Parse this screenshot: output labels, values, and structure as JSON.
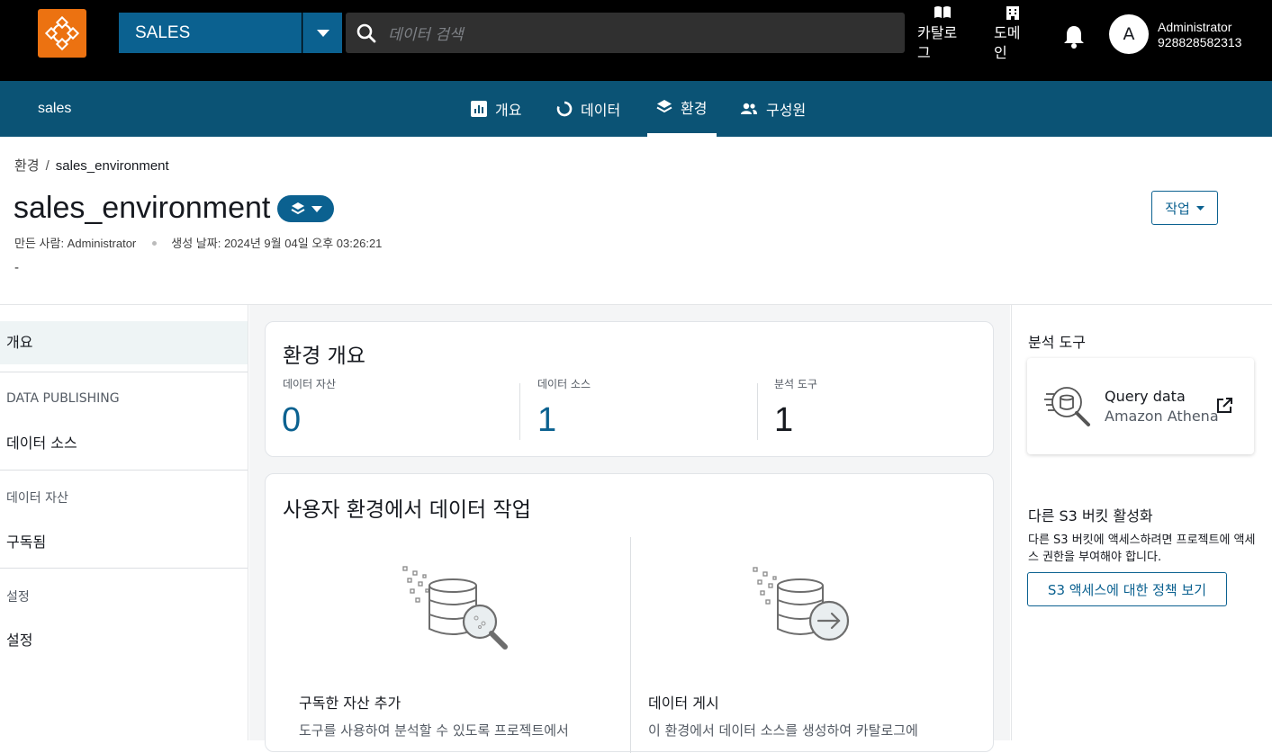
{
  "topbar": {
    "domain_selected": "SALES",
    "search_placeholder": "데이터 검색",
    "catalog_label": "카탈로\n그",
    "domain_label": "도메\n인",
    "avatar_initial": "A",
    "user_name": "Administrator",
    "user_account": "928828582313"
  },
  "project_nav": {
    "project_name": "sales",
    "tabs": [
      {
        "label": "개요",
        "icon": "bar-chart-icon"
      },
      {
        "label": "데이터",
        "icon": "circle-arrow-icon"
      },
      {
        "label": "환경",
        "icon": "layers-icon",
        "active": true
      },
      {
        "label": "구성원",
        "icon": "people-icon"
      }
    ]
  },
  "breadcrumb": {
    "parent": "환경",
    "separator": "/",
    "current": "sales_environment"
  },
  "header": {
    "title": "sales_environment",
    "created_by": "만든 사람: Administrator",
    "created_at": "생성 날짜: 2024년 9월 04일 오후 03:26:21",
    "description": "-",
    "actions_label": "작업"
  },
  "leftnav": {
    "overview": "개요",
    "data_publishing_head": "DATA PUBLISHING",
    "data_sources": "데이터 소스",
    "data_assets_head": "데이터 자산",
    "subscribed": "구독됨",
    "settings_head": "설정",
    "settings": "설정"
  },
  "overview_card": {
    "title": "환경 개요",
    "stats": [
      {
        "label": "데이터 자산",
        "value": "0"
      },
      {
        "label": "데이터 소스",
        "value": "1"
      },
      {
        "label": "분석 도구",
        "value": "1"
      }
    ]
  },
  "work_card": {
    "title": "사용자 환경에서 데이터 작업",
    "left_title": "구독한 자산 추가",
    "left_text": "도구를 사용하여 분석할 수 있도록 프로젝트에서",
    "right_title": "데이터 게시",
    "right_text": "이 환경에서 데이터 소스를 생성하여 카탈로그에"
  },
  "right": {
    "tools_title": "분석 도구",
    "tool_name": "Query data",
    "tool_service": "Amazon Athena",
    "s3_title": "다른 S3 버킷 활성화",
    "s3_text": "다른 S3 버킷에 액세스하려면 프로젝트에 액세스 권한을 부여해야 합니다.",
    "s3_button": "S3 액세스에 대한 정책 보기"
  },
  "colors": {
    "brand_orange": "#ec7211",
    "primary_blue": "#0b6190",
    "project_bar": "#0b5375"
  }
}
